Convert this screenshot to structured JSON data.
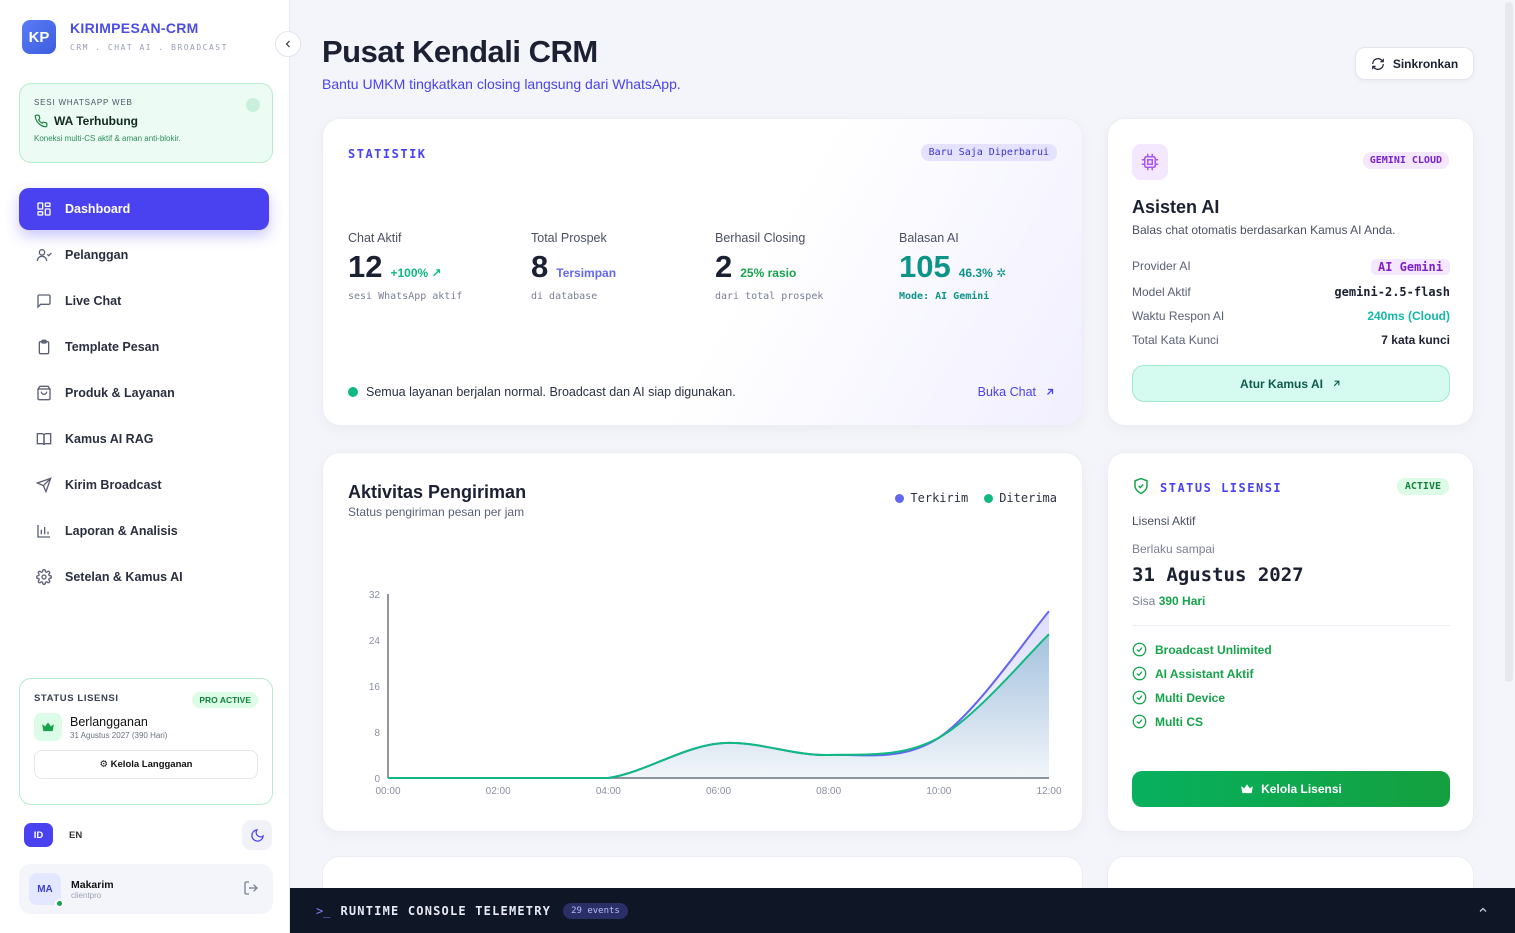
{
  "brand": {
    "logo": "KP",
    "name": "KIRIMPESAN-CRM",
    "subtitle": "CRM . CHAT AI . BROADCAST"
  },
  "wa_session": {
    "label": "SESI WHATSAPP WEB",
    "status": "WA Terhubung",
    "note": "Koneksi multi-CS aktif & aman anti-blokir."
  },
  "nav": [
    {
      "label": "Dashboard",
      "icon": "grid-icon",
      "active": true
    },
    {
      "label": "Pelanggan",
      "icon": "user-icon"
    },
    {
      "label": "Live Chat",
      "icon": "chat-icon"
    },
    {
      "label": "Template Pesan",
      "icon": "clipboard-icon"
    },
    {
      "label": "Produk & Layanan",
      "icon": "bag-icon"
    },
    {
      "label": "Kamus AI RAG",
      "icon": "book-icon"
    },
    {
      "label": "Kirim Broadcast",
      "icon": "send-icon"
    },
    {
      "label": "Laporan & Analisis",
      "icon": "bar-chart-icon"
    },
    {
      "label": "Setelan & Kamus AI",
      "icon": "gear-icon"
    }
  ],
  "sidebar_license": {
    "title": "STATUS LISENSI",
    "badge": "PRO ACTIVE",
    "plan": "Berlangganan",
    "date": "31 Agustus 2027 (390 Hari)",
    "button": "⚙ Kelola Langganan"
  },
  "lang": {
    "id": "ID",
    "en": "EN"
  },
  "user": {
    "initials": "MA",
    "name": "Makarim",
    "role": "clientpro"
  },
  "header": {
    "title": "Pusat Kendali CRM",
    "subtitle": "Bantu UMKM tingkatkan closing langsung dari WhatsApp.",
    "sync_label": "Sinkronkan"
  },
  "stats": {
    "title": "STATISTIK",
    "badge": "Baru Saja Diperbarui",
    "items": [
      {
        "label": "Chat Aktif",
        "value": "12",
        "change": "+100%",
        "sub": "sesi WhatsApp aktif"
      },
      {
        "label": "Total Prospek",
        "value": "8",
        "change": "Tersimpan",
        "sub": "di database"
      },
      {
        "label": "Berhasil Closing",
        "value": "2",
        "change": "25% rasio",
        "sub": "dari total prospek"
      },
      {
        "label": "Balasan AI",
        "value": "105",
        "change": "46.3%",
        "sub": "Mode: AI Gemini"
      }
    ],
    "status_text": "Semua layanan berjalan normal. Broadcast dan AI siap digunakan.",
    "open_chat": "Buka Chat"
  },
  "ai_assistant": {
    "badge": "GEMINI CLOUD",
    "title": "Asisten AI",
    "desc": "Balas chat otomatis berdasarkan Kamus AI Anda.",
    "rows": [
      {
        "key": "Provider AI",
        "value": "AI Gemini"
      },
      {
        "key": "Model Aktif",
        "value": "gemini-2.5-flash"
      },
      {
        "key": "Waktu Respon AI",
        "value": "240ms (Cloud)"
      },
      {
        "key": "Total Kata Kunci",
        "value": "7 kata kunci"
      }
    ],
    "button": "Atur Kamus AI"
  },
  "activity": {
    "title": "Aktivitas Pengiriman",
    "subtitle": "Status pengiriman pesan per jam",
    "legend": [
      "Terkirim",
      "Diterima"
    ]
  },
  "chart_data": {
    "type": "area",
    "title": "Aktivitas Pengiriman",
    "x": [
      "00:00",
      "02:00",
      "04:00",
      "06:00",
      "08:00",
      "10:00",
      "12:00"
    ],
    "series": [
      {
        "name": "Terkirim",
        "color": "#6366f1",
        "values": [
          0,
          0,
          0,
          6,
          4,
          7,
          29
        ]
      },
      {
        "name": "Diterima",
        "color": "#10b981",
        "values": [
          0,
          0,
          0,
          6,
          4,
          7,
          25
        ]
      }
    ],
    "yticks": [
      0,
      8,
      16,
      24,
      32
    ],
    "ylim": [
      0,
      32
    ],
    "legend": "top-right",
    "grid": false
  },
  "license": {
    "title": "STATUS LISENSI",
    "badge": "ACTIVE",
    "active_label": "Lisensi Aktif",
    "valid_label": "Berlaku sampai",
    "valid_date": "31 Agustus 2027",
    "remaining_prefix": "Sisa",
    "remaining": "390 Hari",
    "features": [
      "Broadcast Unlimited",
      "AI Assistant Aktif",
      "Multi Device",
      "Multi CS"
    ],
    "button": "Kelola Lisensi"
  },
  "console": {
    "title": "RUNTIME CONSOLE TELEMETRY",
    "badge": "29 events"
  },
  "colors": {
    "accent": "#4a42f0",
    "success": "#16a34a",
    "teal": "#10b981"
  }
}
